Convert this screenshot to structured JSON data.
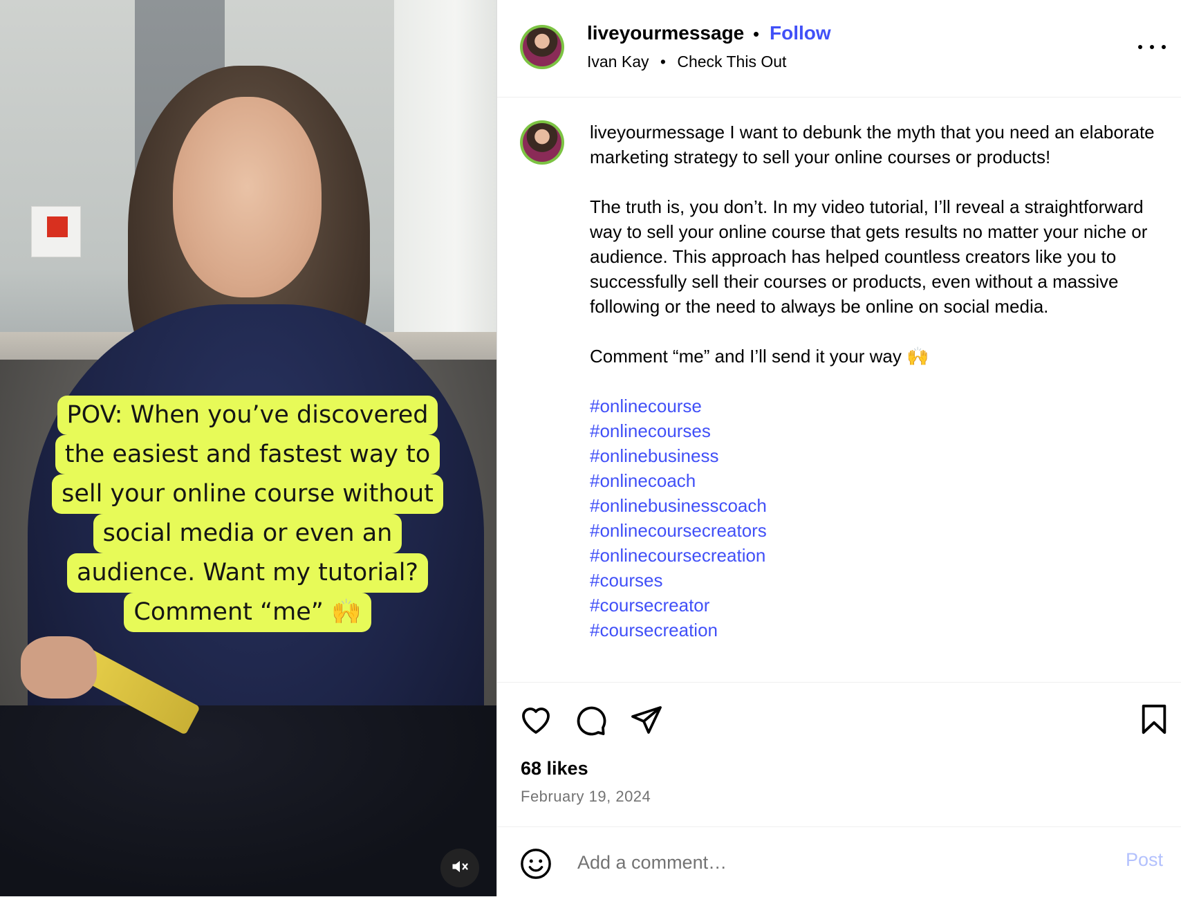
{
  "video": {
    "overlay_lines": [
      "POV: When you’ve discovered",
      "the easiest and fastest way to",
      "sell your online course without",
      "social media or even an",
      "audience. Want my tutorial?",
      "Comment “me” 🙌"
    ],
    "mute_icon": "speaker-muted-icon",
    "overlay_color": "#e7fa58"
  },
  "header": {
    "username": "liveyourmessage",
    "separator": "•",
    "follow_label": "Follow",
    "audio_artist": "Ivan Kay",
    "audio_separator": "•",
    "audio_title": "Check This Out",
    "more_icon": "more-horizontal-icon"
  },
  "caption": {
    "username": "liveyourmessage",
    "paragraph1": "I want to debunk the myth that you need an elaborate marketing strategy to sell your online courses or products!",
    "paragraph2": "The truth is, you don’t. In my video tutorial, I’ll reveal a straightforward way to sell your online course that gets results no matter your niche or audience. This approach has helped countless creators like you to successfully sell their courses or products, even without a massive following or the need to always be online on social media.",
    "paragraph3": "Comment “me” and I’ll send it your way 🙌",
    "hashtags": [
      "#onlinecourse",
      "#onlinecourses",
      "#onlinebusiness",
      "#onlinecoach",
      "#onlinebusinesscoach",
      "#onlinecoursecreators",
      "#onlinecoursecreation",
      "#courses",
      "#coursecreator",
      "#coursecreation"
    ]
  },
  "actions": {
    "like_icon": "heart-icon",
    "comment_icon": "comment-bubble-icon",
    "share_icon": "paper-plane-icon",
    "save_icon": "bookmark-icon",
    "likes_text": "68 likes",
    "date_text": "February 19, 2024"
  },
  "comment_bar": {
    "emoji_icon": "smiley-icon",
    "placeholder": "Add a comment…",
    "post_label": "Post"
  },
  "colors": {
    "link_blue": "#4150f7",
    "post_disabled": "#b3c1fd",
    "muted_text": "#737373",
    "avatar_ring": "#7cc343"
  }
}
